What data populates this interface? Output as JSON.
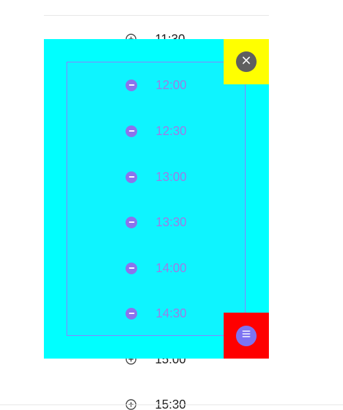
{
  "colors": {
    "overlay": "#00ffff",
    "inner_selection": "#0ef4ff",
    "selection_border": "#8f7dff",
    "selected_text": "#9b7de6",
    "remove_icon": "#8a74ec",
    "close_handle_bg": "#ffff00",
    "close_button": "#5f5f5f",
    "menu_handle_bg": "#ff0000",
    "menu_button": "#7d73f2",
    "unselected_text": "#222222"
  },
  "background_slots": [
    {
      "time": "11:30",
      "icon": "add-circle-icon"
    },
    {
      "time": "15:00",
      "icon": "add-circle-icon"
    },
    {
      "time": "15:30",
      "icon": "add-circle-icon"
    }
  ],
  "selected_slots": [
    {
      "time": "12:00",
      "icon": "remove-circle-icon"
    },
    {
      "time": "12:30",
      "icon": "remove-circle-icon"
    },
    {
      "time": "13:00",
      "icon": "remove-circle-icon"
    },
    {
      "time": "13:30",
      "icon": "remove-circle-icon"
    },
    {
      "time": "14:00",
      "icon": "remove-circle-icon"
    },
    {
      "time": "14:30",
      "icon": "remove-circle-icon"
    }
  ],
  "handles": {
    "close_icon": "close-icon",
    "menu_icon": "menu-icon"
  }
}
